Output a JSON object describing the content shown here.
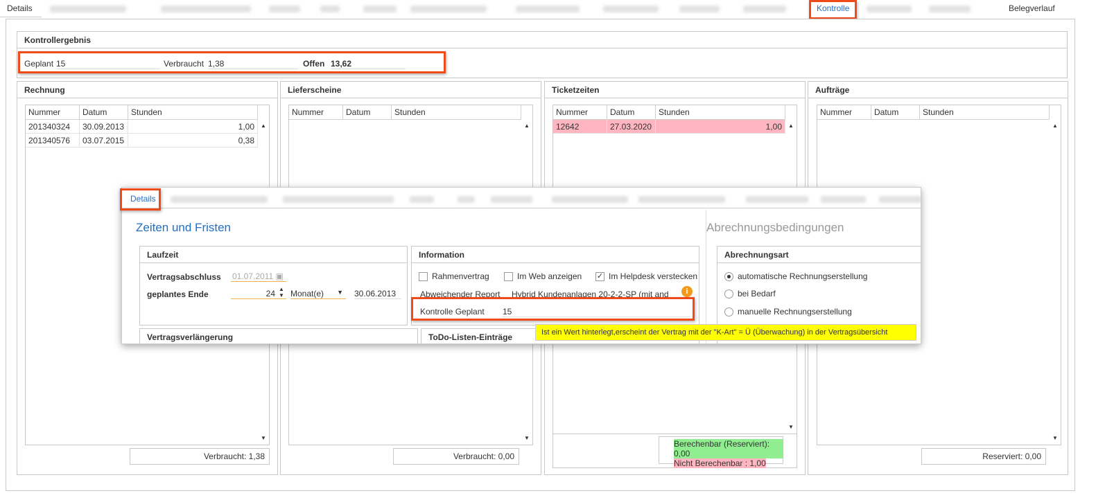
{
  "top_tabs": {
    "details": "Details",
    "kontrolle": "Kontrolle",
    "belegverlauf": "Belegverlauf"
  },
  "kontrollergebnis": {
    "title": "Kontrollergebnis",
    "geplant_label": "Geplant",
    "geplant_value": "15",
    "verbraucht_label": "Verbraucht",
    "verbraucht_value": "1,38",
    "offen_label": "Offen",
    "offen_value": "13,62"
  },
  "columns": [
    "Nummer",
    "Datum",
    "Stunden"
  ],
  "rechnung": {
    "title": "Rechnung",
    "rows": [
      {
        "nummer": "201340324",
        "datum": "30.09.2013",
        "stunden": "1,00"
      },
      {
        "nummer": "201340576",
        "datum": "03.07.2015",
        "stunden": "0,38"
      }
    ],
    "footer": "Verbraucht: 1,38"
  },
  "lieferscheine": {
    "title": "Lieferscheine",
    "footer": "Verbraucht: 0,00"
  },
  "ticketzeiten": {
    "title": "Ticketzeiten",
    "rows": [
      {
        "nummer": "12642",
        "datum": "27.03.2020",
        "stunden": "1,00"
      }
    ],
    "footer_green": "Berechenbar (Reserviert): 0,00",
    "footer_red": "Nicht Berechenbar : 1,00"
  },
  "auftraege": {
    "title": "Aufträge",
    "footer": "Reserviert: 0,00"
  },
  "popup": {
    "tab_details": "Details",
    "heading_left": "Zeiten und Fristen",
    "heading_right": "Abrechnungsbedingungen",
    "laufzeit": {
      "title": "Laufzeit",
      "vertragsabschluss_label": "Vertragsabschluss",
      "vertragsabschluss_value": "01.07.2011",
      "ende_label": "geplantes Ende",
      "ende_value": "24",
      "einheit": "Monat(e)",
      "ende_datum": "30.06.2013"
    },
    "information": {
      "title": "Information",
      "rahmenvertrag": "Rahmenvertrag",
      "im_web": "Im Web anzeigen",
      "helpdesk": "Im Helpdesk verstecken",
      "report_label": "Abweichender Report",
      "report_value": "Hybrid Kundenanlagen 20-2-2-SP (mit and",
      "kontrolle_label": "Kontrolle Geplant",
      "kontrolle_value": "15"
    },
    "vertragsverlaengerung": "Vertragsverlängerung",
    "todo": "ToDo-Listen-Einträge",
    "abrechnungsart": {
      "title": "Abrechnungsart",
      "options": [
        "automatische Rechnungserstellung",
        "bei Bedarf",
        "manuelle Rechnungserstellung"
      ]
    },
    "tooltip": "Ist ein Wert hinterlegt,erscheint der Vertrag mit der \"K-Art\" = Ü (Überwachung) in der Vertragsübersicht"
  }
}
